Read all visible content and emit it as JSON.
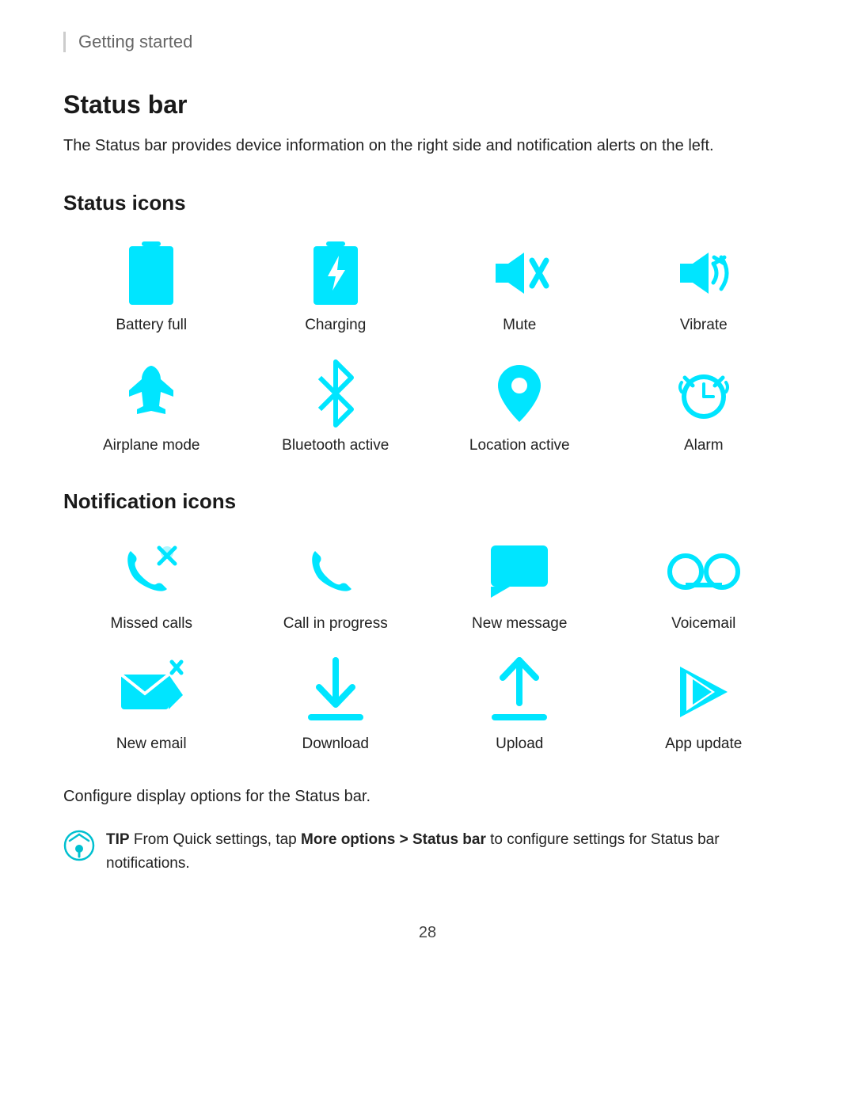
{
  "breadcrumb": "Getting started",
  "section": {
    "title": "Status bar",
    "desc": "The Status bar provides device information on the right side and notification alerts on the left."
  },
  "status_icons_title": "Status icons",
  "status_icons": [
    {
      "label": "Battery full",
      "icon": "battery-full"
    },
    {
      "label": "Charging",
      "icon": "charging"
    },
    {
      "label": "Mute",
      "icon": "mute"
    },
    {
      "label": "Vibrate",
      "icon": "vibrate"
    },
    {
      "label": "Airplane mode",
      "icon": "airplane"
    },
    {
      "label": "Bluetooth active",
      "icon": "bluetooth"
    },
    {
      "label": "Location active",
      "icon": "location"
    },
    {
      "label": "Alarm",
      "icon": "alarm"
    }
  ],
  "notification_icons_title": "Notification icons",
  "notification_icons": [
    {
      "label": "Missed calls",
      "icon": "missed-calls"
    },
    {
      "label": "Call in progress",
      "icon": "call-progress"
    },
    {
      "label": "New message",
      "icon": "new-message"
    },
    {
      "label": "Voicemail",
      "icon": "voicemail"
    },
    {
      "label": "New email",
      "icon": "new-email"
    },
    {
      "label": "Download",
      "icon": "download"
    },
    {
      "label": "Upload",
      "icon": "upload"
    },
    {
      "label": "App update",
      "icon": "app-update"
    }
  ],
  "configure_text": "Configure display options for the Status bar.",
  "tip": {
    "prefix": "TIP",
    "text": " From Quick settings, tap ",
    "bold_text": "More options > Status bar",
    "suffix": " to configure settings for Status bar notifications."
  },
  "page_number": "28"
}
